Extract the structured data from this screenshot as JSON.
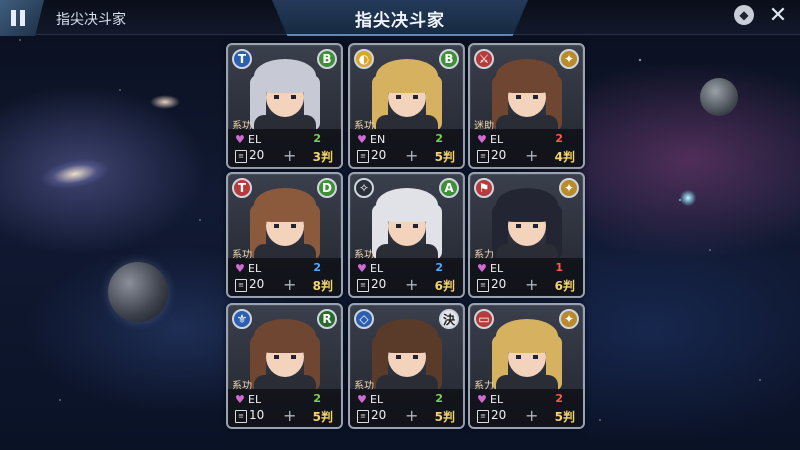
{
  "header": {
    "left_title": "指尖决斗家",
    "center_title": "指尖决斗家",
    "help_icon": "shield-help-icon",
    "close_icon": "close-icon"
  },
  "colors": {
    "blue_stat": "#51a8ff",
    "green_stat": "#7ad34f",
    "red_stat": "#ff5a4a",
    "gold_text": "#f3d36b"
  },
  "cards": [
    {
      "left_badge": "T",
      "right_badge": "B",
      "class_label": "系功",
      "stat_top": "EL",
      "num_top": "2",
      "num_top_color": "green",
      "deck_count": "20",
      "bottom_text": "3判",
      "hair": "#c7c9d5",
      "badge_left_color": "blue",
      "badge_right_color": "green"
    },
    {
      "left_badge": "◐",
      "right_badge": "B",
      "class_label": "系功",
      "stat_top": "EN",
      "num_top": "2",
      "num_top_color": "green",
      "deck_count": "20",
      "bottom_text": "5判",
      "hair": "#d6b260",
      "badge_left_color": "yellow",
      "badge_right_color": "green"
    },
    {
      "left_badge": "⚔",
      "right_badge": "✦",
      "class_label": "迷助",
      "stat_top": "EL",
      "num_top": "2",
      "num_top_color": "red",
      "deck_count": "20",
      "bottom_text": "4判",
      "hair": "#6e4632",
      "badge_left_color": "red",
      "badge_right_color": "gold"
    },
    {
      "left_badge": "T",
      "right_badge": "D",
      "class_label": "系功",
      "stat_top": "EL",
      "num_top": "2",
      "num_top_color": "blue",
      "deck_count": "20",
      "bottom_text": "8判",
      "hair": "#8b5a3c",
      "badge_left_color": "red",
      "badge_right_color": "green"
    },
    {
      "left_badge": "✧",
      "right_badge": "A",
      "class_label": "系功",
      "stat_top": "EL",
      "num_top": "2",
      "num_top_color": "blue",
      "deck_count": "20",
      "bottom_text": "6判",
      "hair": "#e0e2e8",
      "badge_left_color": "dark",
      "badge_right_color": "green"
    },
    {
      "left_badge": "⚑",
      "right_badge": "✦",
      "class_label": "系力",
      "stat_top": "EL",
      "num_top": "1",
      "num_top_color": "red",
      "deck_count": "20",
      "bottom_text": "6判",
      "hair": "#232532",
      "badge_left_color": "red",
      "badge_right_color": "gold"
    },
    {
      "left_badge": "⚜",
      "right_badge": "R",
      "class_label": "系功",
      "stat_top": "EL",
      "num_top": "2",
      "num_top_color": "green",
      "deck_count": "10",
      "bottom_text": "5判",
      "hair": "#6e4632",
      "badge_left_color": "blue",
      "badge_right_color": "darkgreen"
    },
    {
      "left_badge": "◇",
      "right_badge": "決",
      "class_label": "系功",
      "stat_top": "EL",
      "num_top": "2",
      "num_top_color": "green",
      "deck_count": "20",
      "bottom_text": "5判",
      "hair": "#5a3b2a",
      "badge_left_color": "blue",
      "badge_right_color": "white"
    },
    {
      "left_badge": "▭",
      "right_badge": "✦",
      "class_label": "系力",
      "stat_top": "EL",
      "num_top": "2",
      "num_top_color": "red",
      "deck_count": "20",
      "bottom_text": "5判",
      "hair": "#d6b260",
      "badge_left_color": "red",
      "badge_right_color": "gold"
    }
  ]
}
